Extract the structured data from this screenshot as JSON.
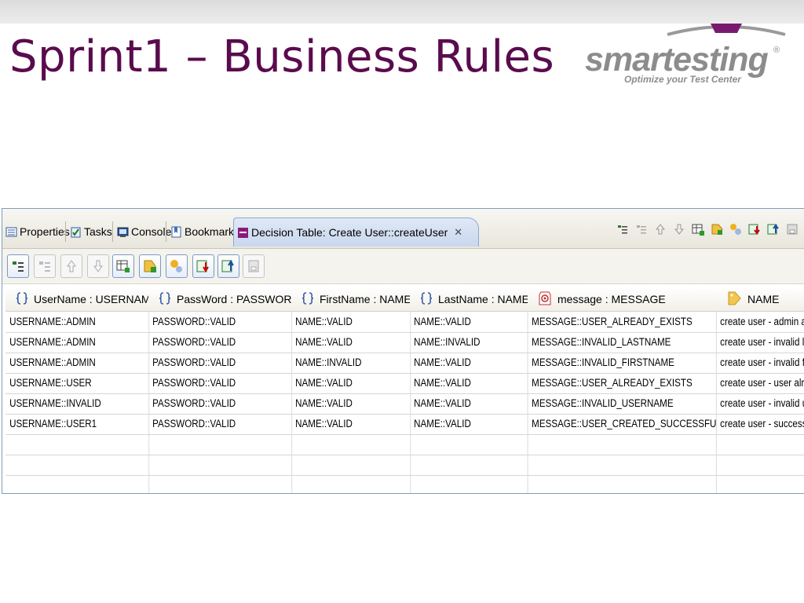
{
  "slide": {
    "title": "Sprint1 – Business Rules",
    "logo_text": "smartesting",
    "logo_reg": "®",
    "logo_tagline": "Optimize your Test Center"
  },
  "tabs": [
    {
      "label": "Properties",
      "icon": "properties-icon"
    },
    {
      "label": "Tasks",
      "icon": "tasks-icon"
    },
    {
      "label": "Console",
      "icon": "console-icon"
    },
    {
      "label": "Bookmarks",
      "icon": "bookmarks-icon"
    },
    {
      "label": "Decision Table: Create User::createUser",
      "icon": "decision-table-icon",
      "active": true,
      "close": "✕"
    }
  ],
  "toolbar": {
    "buttons": [
      "add-row",
      "remove-row",
      "move-up",
      "move-down",
      "add-column",
      "add-tag",
      "add-value",
      "import",
      "export",
      "save"
    ]
  },
  "table": {
    "columns": [
      {
        "label": "UserName : USERNAME",
        "icon": "parameter-icon"
      },
      {
        "label": "PassWord : PASSWORD",
        "icon": "parameter-icon"
      },
      {
        "label": "FirstName : NAME",
        "icon": "parameter-icon"
      },
      {
        "label": "LastName : NAME",
        "icon": "parameter-icon"
      },
      {
        "label": "message : MESSAGE",
        "icon": "message-icon"
      },
      {
        "label": "NAME",
        "icon": "tag-icon"
      }
    ],
    "rows": [
      [
        "USERNAME::ADMIN",
        "PASSWORD::VALID",
        "NAME::VALID",
        "NAME::VALID",
        "MESSAGE::USER_ALREADY_EXISTS",
        "create user - admin a"
      ],
      [
        "USERNAME::ADMIN",
        "PASSWORD::VALID",
        "NAME::VALID",
        "NAME::INVALID",
        "MESSAGE::INVALID_LASTNAME",
        "create user - invalid l"
      ],
      [
        "USERNAME::ADMIN",
        "PASSWORD::VALID",
        "NAME::INVALID",
        "NAME::VALID",
        "MESSAGE::INVALID_FIRSTNAME",
        "create user - invalid f"
      ],
      [
        "USERNAME::USER",
        "PASSWORD::VALID",
        "NAME::VALID",
        "NAME::VALID",
        "MESSAGE::USER_ALREADY_EXISTS",
        "create user - user alr"
      ],
      [
        "USERNAME::INVALID",
        "PASSWORD::VALID",
        "NAME::VALID",
        "NAME::VALID",
        "MESSAGE::INVALID_USERNAME",
        "create user - invalid u"
      ],
      [
        "USERNAME::USER1",
        "PASSWORD::VALID",
        "NAME::VALID",
        "NAME::VALID",
        "MESSAGE::USER_CREATED_SUCCESSFULLY",
        "create user - success"
      ],
      [
        "",
        "",
        "",
        "",
        "",
        ""
      ],
      [
        "",
        "",
        "",
        "",
        "",
        ""
      ],
      [
        "",
        "",
        "",
        "",
        "",
        ""
      ]
    ]
  },
  "colors": {
    "title": "#5a0b4d",
    "logo_gray": "#8c8c8c",
    "logo_accent": "#7a1a6e",
    "tab_active": "#c9d8ee",
    "border": "#7f9db9"
  }
}
